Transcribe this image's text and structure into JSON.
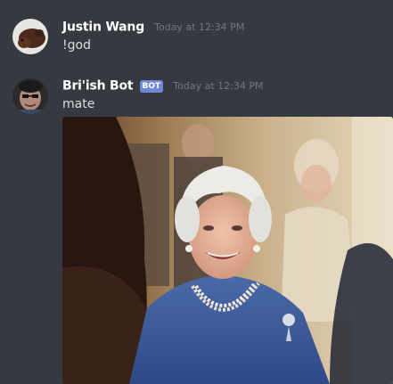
{
  "messages": [
    {
      "author": "Justin Wang",
      "timestamp": "Today at 12:34 PM",
      "content": "!god",
      "avatar_icon": "user-avatar"
    },
    {
      "author": "Bri'ish Bot",
      "bot_tag": "BOT",
      "timestamp": "Today at 12:34 PM",
      "content": "mate",
      "avatar_icon": "bot-avatar",
      "attachment": "image-attachment"
    }
  ],
  "colors": {
    "background": "#36393f",
    "username": "#ffffff",
    "message_text": "#dcddde",
    "timestamp": "#72767d",
    "bot_tag": "#7289da"
  }
}
